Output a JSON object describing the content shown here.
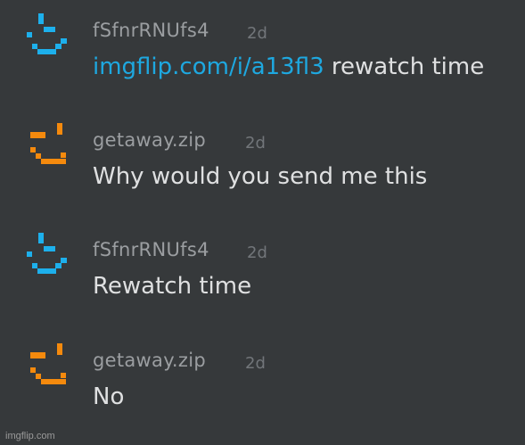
{
  "colors": {
    "background": "#36393b",
    "username": "#9b9ea1",
    "timestamp": "#72767a",
    "message_text": "#dfe0e1",
    "link": "#1ea8e0",
    "avatar_blue": "#1db0ec",
    "avatar_orange": "#f58a0d"
  },
  "messages": [
    {
      "username": "fSfnrRNUfs4",
      "timestamp": "2d",
      "avatar_icon": "blue-pixel-smiley-icon",
      "link": "imgflip.com/i/a13fl3",
      "text": " rewatch time"
    },
    {
      "username": "getaway.zip",
      "timestamp": "2d",
      "avatar_icon": "orange-pixel-smiley-icon",
      "text": "Why would you send me this"
    },
    {
      "username": "fSfnrRNUfs4",
      "timestamp": "2d",
      "avatar_icon": "blue-pixel-smiley-icon",
      "text": "Rewatch time"
    },
    {
      "username": "getaway.zip",
      "timestamp": "2d",
      "avatar_icon": "orange-pixel-smiley-icon",
      "text": "No"
    }
  ],
  "watermark": "imgflip.com"
}
